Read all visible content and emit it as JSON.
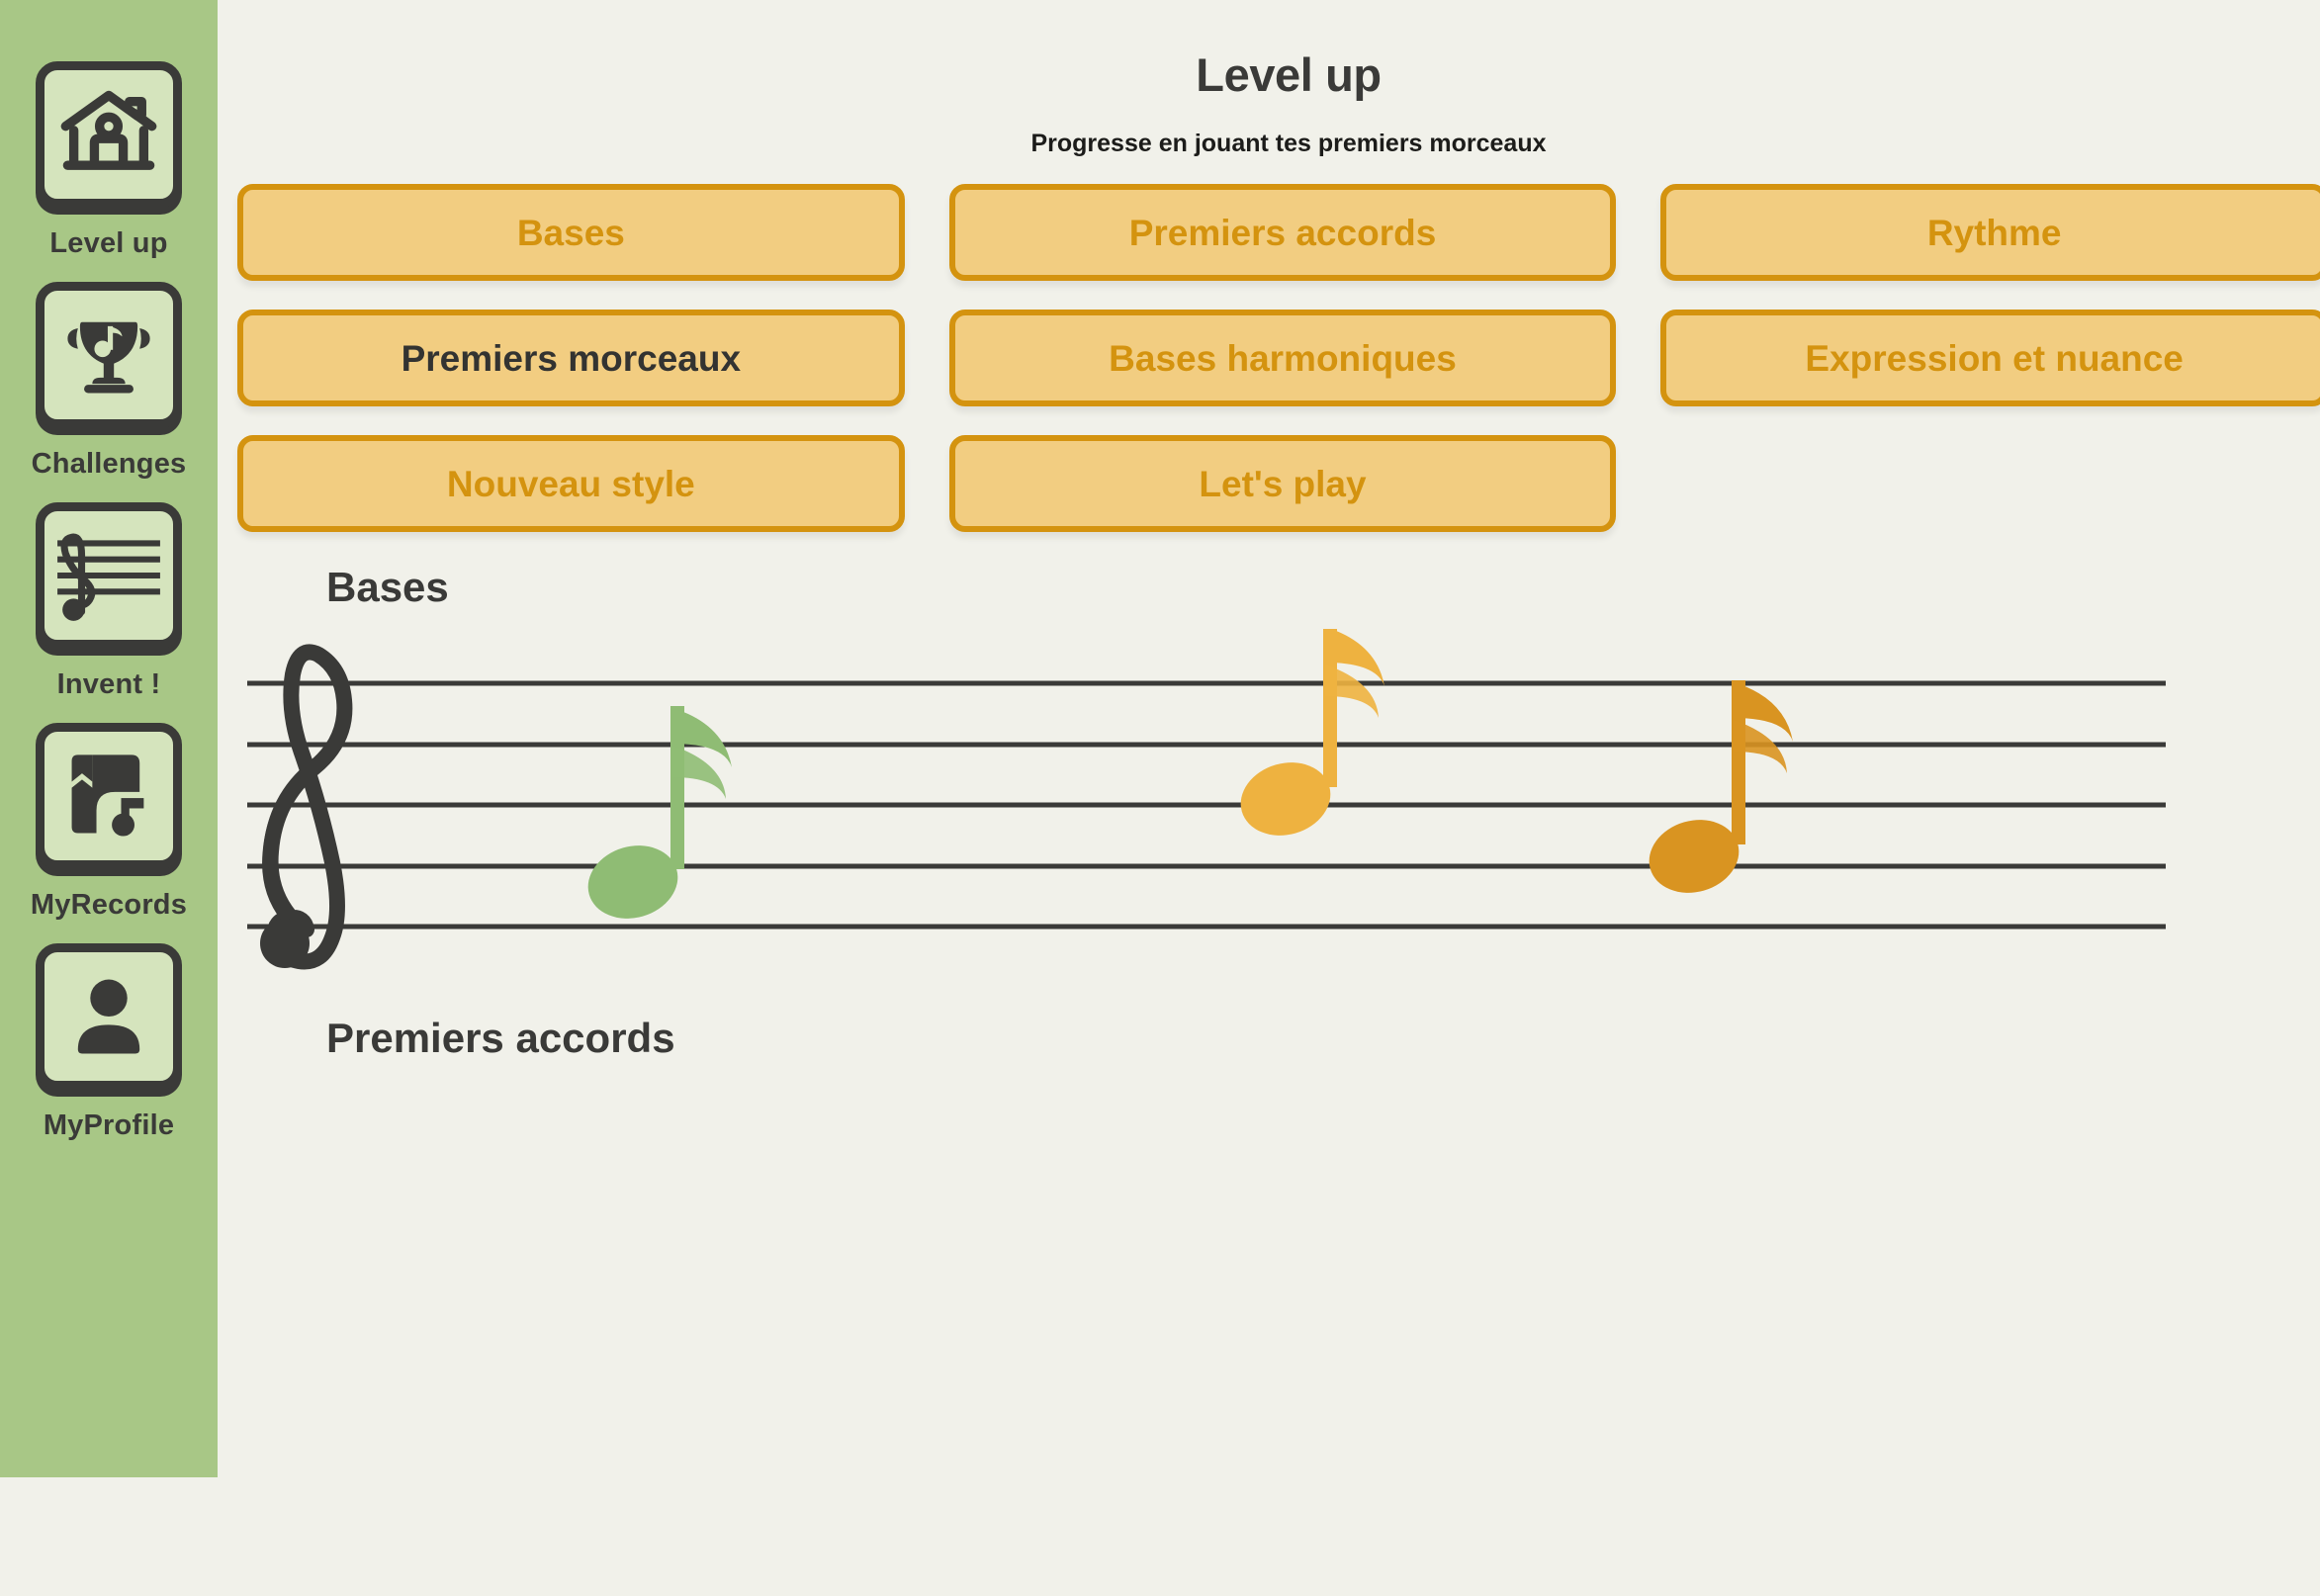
{
  "sidebar": {
    "items": [
      {
        "label": "Level up",
        "icon": "house-icon"
      },
      {
        "label": "Challenges",
        "icon": "trophy-music-icon"
      },
      {
        "label": "Invent !",
        "icon": "staff-clef-icon"
      },
      {
        "label": "MyRecords",
        "icon": "book-music-icon"
      },
      {
        "label": "MyProfile",
        "icon": "person-icon"
      }
    ]
  },
  "header": {
    "title": "Level up",
    "subtitle": "Progresse en jouant tes premiers morceaux"
  },
  "lessons": [
    {
      "label": "Bases",
      "active": false
    },
    {
      "label": "Premiers accords",
      "active": false
    },
    {
      "label": "Rythme",
      "active": false
    },
    {
      "label": "Premiers morceaux",
      "active": true
    },
    {
      "label": "Bases harmoniques",
      "active": false
    },
    {
      "label": "Expression et nuance",
      "active": false
    },
    {
      "label": "Nouveau style",
      "active": false
    },
    {
      "label": "Let's play",
      "active": false
    }
  ],
  "sections": [
    {
      "heading": "Bases"
    },
    {
      "heading": "Premiers accords"
    }
  ],
  "staff": {
    "clef": "treble-clef",
    "notes": [
      {
        "color": "#8fbc74",
        "pitch_line": 4,
        "name": "eighth-note-green"
      },
      {
        "color": "#eeb240",
        "pitch_line": 2,
        "name": "eighth-note-orange"
      },
      {
        "color": "#d99421",
        "pitch_line": 3,
        "name": "eighth-note-amber"
      }
    ]
  },
  "colors": {
    "sidebar_green": "#a8c786",
    "icon_tile_green": "#d5e4bd",
    "ink": "#3a3a38",
    "button_fill": "#f2cd81",
    "button_border": "#d4930f",
    "button_text": "#d4930f",
    "background": "#f1f1ea"
  }
}
